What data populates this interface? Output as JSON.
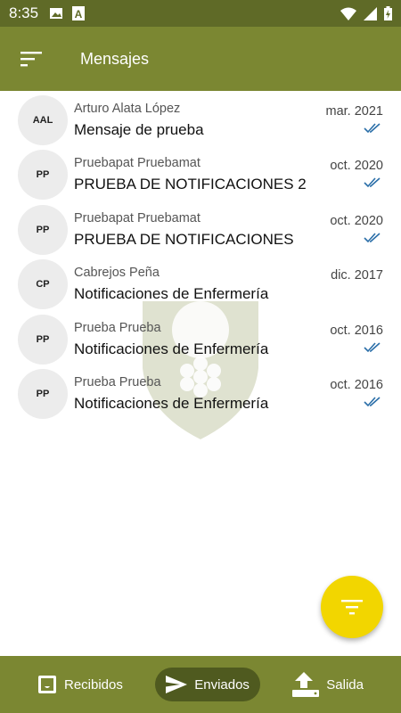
{
  "status_bar": {
    "time": "8:35",
    "left_icons": [
      "image-icon",
      "app-a-icon"
    ],
    "right_icons": [
      "wifi-icon",
      "cell-signal-icon",
      "battery-icon"
    ]
  },
  "app_bar": {
    "title": "Mensajes",
    "menu_icon": "sort-menu-icon",
    "color": "#7b8732"
  },
  "messages": [
    {
      "initials": "AAL",
      "sender": "Arturo Alata López",
      "subject": "Mensaje de prueba",
      "date": "mar. 2021",
      "read": true
    },
    {
      "initials": "PP",
      "sender": "Pruebapat Pruebamat",
      "subject": "PRUEBA DE NOTIFICACIONES 2",
      "date": "oct. 2020",
      "read": true
    },
    {
      "initials": "PP",
      "sender": "Pruebapat Pruebamat",
      "subject": "PRUEBA DE NOTIFICACIONES",
      "date": "oct. 2020",
      "read": true
    },
    {
      "initials": "CP",
      "sender": "Cabrejos Peña",
      "subject": "Notificaciones de Enfermería",
      "date": "dic. 2017",
      "read": false
    },
    {
      "initials": "PP",
      "sender": "Prueba Prueba",
      "subject": "Notificaciones de Enfermería",
      "date": "oct. 2016",
      "read": true
    },
    {
      "initials": "PP",
      "sender": "Prueba Prueba",
      "subject": "Notificaciones de Enfermería",
      "date": "oct. 2016",
      "read": true
    }
  ],
  "fab": {
    "icon": "filter-icon",
    "color": "#f2d600"
  },
  "bottom_nav": [
    {
      "label": "Recibidos",
      "icon": "inbox-icon",
      "active": false
    },
    {
      "label": "Enviados",
      "icon": "send-icon",
      "active": true
    },
    {
      "label": "Salida",
      "icon": "upload-icon",
      "active": false
    }
  ],
  "colors": {
    "accent": "#7b8732",
    "read_check": "#2a6ea8"
  }
}
